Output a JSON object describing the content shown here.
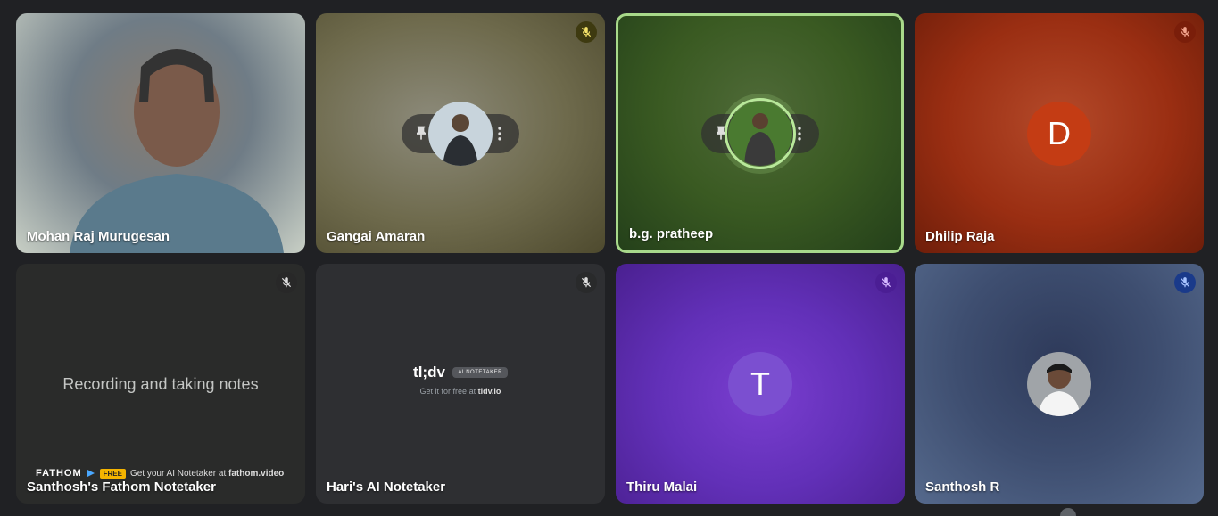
{
  "participants": [
    {
      "name": "Mohan Raj Murugesan"
    },
    {
      "name": "Gangai Amaran",
      "muted": true
    },
    {
      "name": "b.g. pratheep",
      "speaking": true
    },
    {
      "name": "Dhilip Raja",
      "initial": "D",
      "muted": true,
      "color": "#c43c14"
    },
    {
      "name": "Santhosh's Fathom Notetaker",
      "muted": true,
      "status_text": "Recording and taking notes",
      "fathom": {
        "logo": "FATHOM",
        "badge": "FREE",
        "text_pre": "Get your AI Notetaker at",
        "text_link": "fathom.video"
      }
    },
    {
      "name": "Hari's AI Notetaker",
      "muted": true,
      "tldv": {
        "logo": "tl;dv",
        "badge": "AI NOTETAKER",
        "sub_pre": "Get it for free at",
        "sub_link": "tldv.io"
      }
    },
    {
      "name": "Thiru Malai",
      "initial": "T",
      "muted": true,
      "color": "#7b4fd0"
    },
    {
      "name": "Santhosh R",
      "muted": true
    }
  ],
  "colors": {
    "speaking_border": "#a8d98a",
    "background": "#202124"
  }
}
